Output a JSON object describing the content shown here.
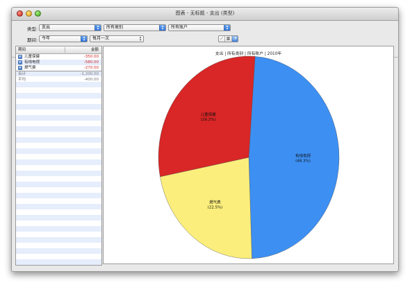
{
  "window": {
    "title": "图表 - 无标题 - 支出 (类型)"
  },
  "toolbar": {
    "type_label": "类型:",
    "type_value": "支出",
    "category_value": "所有类别",
    "account_value": "所有账户",
    "period_label": "期间:",
    "period_value": "今年",
    "interval_value": "每月一次",
    "chart_buttons": [
      "line-chart-icon",
      "bar-chart-icon",
      "pie-chart-icon"
    ]
  },
  "sidebar": {
    "col_period": "期间",
    "col_amount": "金额",
    "items": [
      {
        "label": "儿童保健",
        "amount": "-350.00",
        "checked": true
      },
      {
        "label": "有线电视",
        "amount": "-580.00",
        "checked": true
      },
      {
        "label": "燃气费",
        "amount": "-270.00",
        "checked": true
      }
    ],
    "total_label": "合计",
    "total_amount": "-1,200.00",
    "average_label": "平均",
    "average_amount": "-400.00"
  },
  "chart": {
    "title": "支出 | 所有类别 | 所有账户 | 2010年"
  },
  "chart_data": {
    "type": "pie",
    "title": "支出 | 所有类别 | 所有账户 | 2010年",
    "slices": [
      {
        "label": "有线电视",
        "value": 580,
        "percent_label": "(48.3%)",
        "color": "#3d8ff2"
      },
      {
        "label": "燃气费",
        "value": 270,
        "percent_label": "(22.5%)",
        "color": "#fbee7c"
      },
      {
        "label": "儿童保健",
        "value": 350,
        "percent_label": "(29.2%)",
        "color": "#d92626"
      }
    ]
  }
}
